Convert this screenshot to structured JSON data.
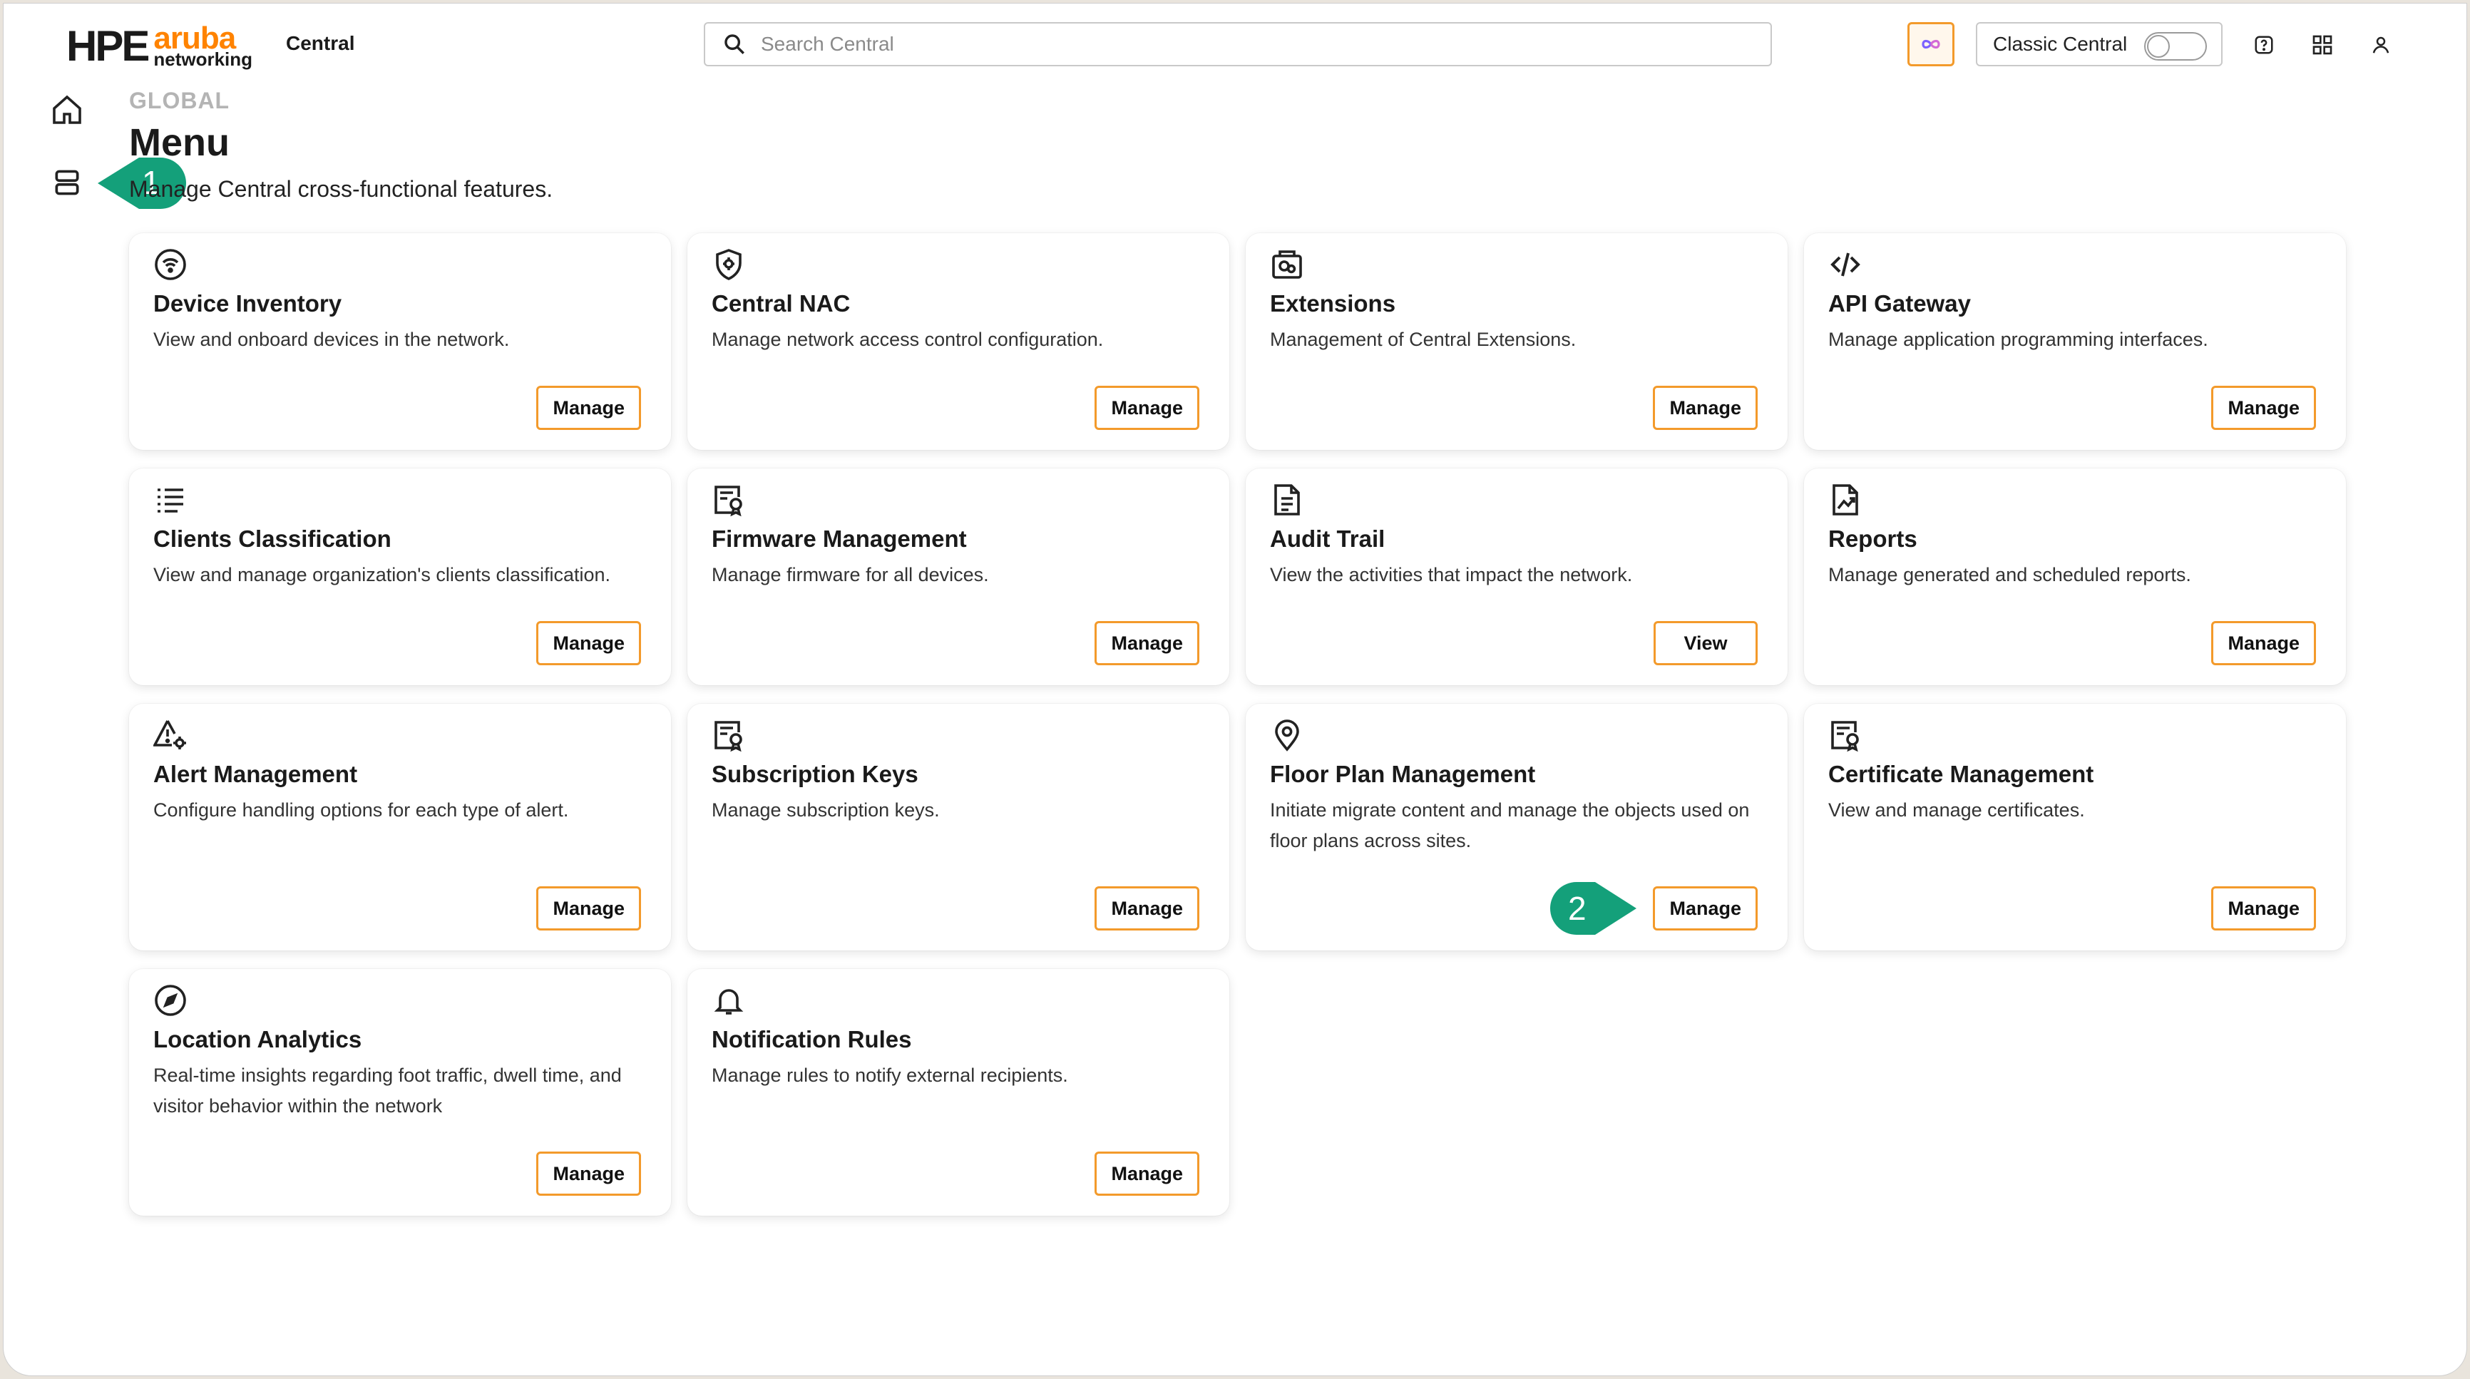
{
  "header": {
    "logo_brand": "HPE",
    "logo_aruba": "aruba",
    "logo_networking": "networking",
    "app_name": "Central",
    "search_placeholder": "Search Central",
    "classic_label": "Classic Central",
    "classic_toggle_on": false
  },
  "page": {
    "eyebrow": "GLOBAL",
    "title": "Menu",
    "subtitle": "Manage Central cross-functional features."
  },
  "callouts": [
    "1",
    "2"
  ],
  "cards": [
    {
      "icon": "wifi-circle-icon",
      "title": "Device Inventory",
      "desc": "View and onboard devices in the network.",
      "button": "Manage"
    },
    {
      "icon": "shield-gear-icon",
      "title": "Central NAC",
      "desc": "Manage network access control configuration.",
      "button": "Manage"
    },
    {
      "icon": "extensions-icon",
      "title": "Extensions",
      "desc": "Management of Central Extensions.",
      "button": "Manage"
    },
    {
      "icon": "code-icon",
      "title": "API Gateway",
      "desc": "Manage application programming interfaces.",
      "button": "Manage"
    },
    {
      "icon": "list-icon",
      "title": "Clients Classification",
      "desc": "View and manage organization's clients classification.",
      "button": "Manage"
    },
    {
      "icon": "certificate-icon",
      "title": "Firmware Management",
      "desc": "Manage firmware for all devices.",
      "button": "Manage"
    },
    {
      "icon": "document-icon",
      "title": "Audit Trail",
      "desc": "View the activities that impact the network.",
      "button": "View"
    },
    {
      "icon": "report-chart-icon",
      "title": "Reports",
      "desc": "Manage generated and scheduled reports.",
      "button": "Manage"
    },
    {
      "icon": "alert-gear-icon",
      "title": "Alert Management",
      "desc": "Configure handling options for each type of alert.",
      "button": "Manage"
    },
    {
      "icon": "certificate-icon",
      "title": "Subscription Keys",
      "desc": "Manage subscription keys.",
      "button": "Manage"
    },
    {
      "icon": "location-pin-icon",
      "title": "Floor Plan Management",
      "desc": "Initiate migrate content and manage the objects used on floor plans across sites.",
      "button": "Manage"
    },
    {
      "icon": "certificate-icon",
      "title": "Certificate Management",
      "desc": "View and manage certificates.",
      "button": "Manage"
    },
    {
      "icon": "compass-icon",
      "title": "Location Analytics",
      "desc": "Real-time insights regarding foot traffic, dwell time, and visitor behavior within the network",
      "button": "Manage"
    },
    {
      "icon": "bell-icon",
      "title": "Notification Rules",
      "desc": "Manage rules to notify external recipients.",
      "button": "Manage"
    }
  ],
  "colors": {
    "accent": "#f39a2b",
    "callout": "#14a07a",
    "brand_orange": "#ff8300"
  }
}
